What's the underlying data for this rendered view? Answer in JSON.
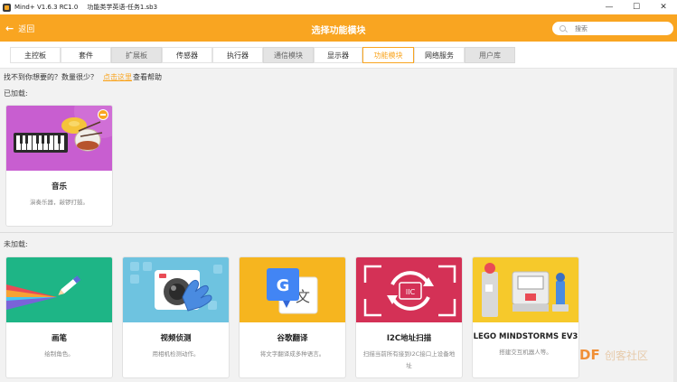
{
  "window": {
    "app_title": "Mind+ V1.6.3 RC1.0",
    "file_title": "功能类学英语-任务1.sb3",
    "controls": [
      "—",
      "☐",
      "✕"
    ]
  },
  "header": {
    "back_label": "返回",
    "title": "选择功能模块",
    "search_placeholder": "搜索"
  },
  "tabs": [
    {
      "label": "主控板"
    },
    {
      "label": "套件"
    },
    {
      "label": "扩展板"
    },
    {
      "label": "传感器"
    },
    {
      "label": "执行器"
    },
    {
      "label": "通信模块"
    },
    {
      "label": "显示器"
    },
    {
      "label": "功能模块"
    },
    {
      "label": "网络服务"
    },
    {
      "label": "用户库"
    }
  ],
  "active_tab": "功能模块",
  "help": {
    "text": "找不到你想要的？数量很少？",
    "link": "点击这里",
    "suffix": "查看帮助"
  },
  "loaded": {
    "label": "已加载:",
    "items": [
      {
        "name": "音乐",
        "desc": "演奏乐器，敲锣打鼓。"
      }
    ]
  },
  "unloaded": {
    "label": "未加载:",
    "items": [
      {
        "name": "画笔",
        "desc": "绘制角色。"
      },
      {
        "name": "视频侦测",
        "desc": "用相机检测动作。"
      },
      {
        "name": "谷歌翻译",
        "desc": "将文字翻译成多种语言。"
      },
      {
        "name": "I2C地址扫描",
        "desc": "扫描当前所有接到I2C接口上设备地址"
      },
      {
        "name": "LEGO MINDSTORMS EV3",
        "desc": "搭建交互机器人等。"
      }
    ]
  },
  "watermark": {
    "brand": "DF",
    "text": "创客社区"
  },
  "colors": {
    "accent": "#f9a521",
    "music_bg": "#c85ed0",
    "pen_bg": "#1eb586",
    "video_bg": "#6ec3e0",
    "translate_bg": "#f6b51f",
    "i2c_bg": "#d43156",
    "ev3_bg": "#f6c92b"
  },
  "icons": [
    "back-arrow-icon",
    "search-icon",
    "remove-icon",
    "piano-icon",
    "pen-icon",
    "camera-icon",
    "google-translate-icon",
    "i2c-scan-icon",
    "lego-robot-icon"
  ]
}
